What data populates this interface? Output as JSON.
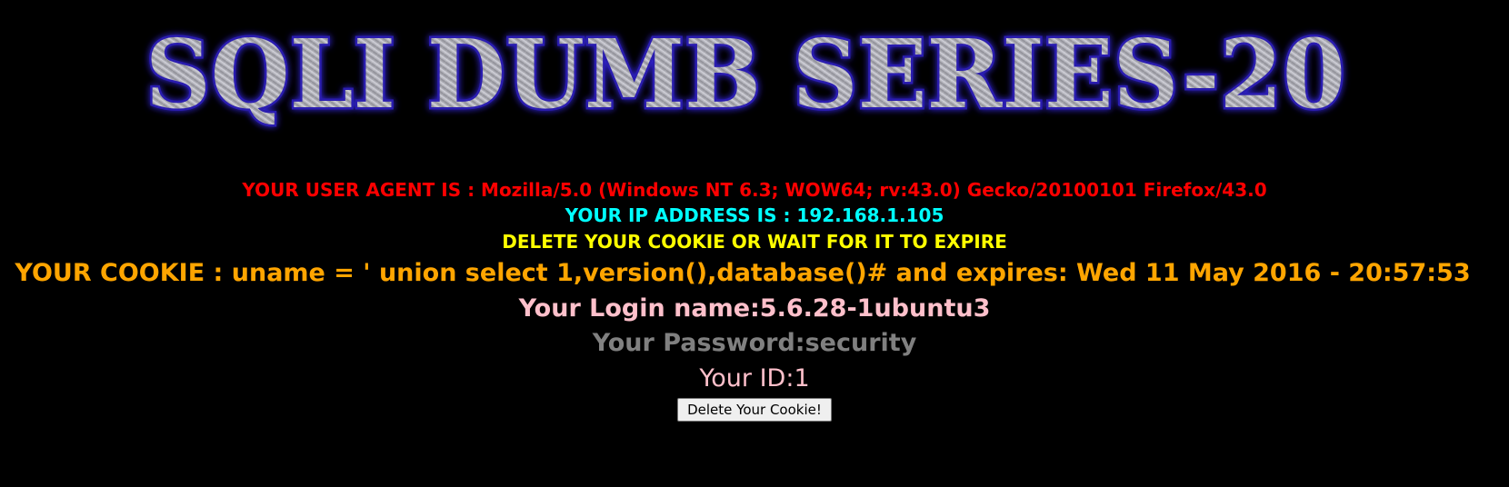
{
  "banner": {
    "text": "SQLI DUMB SERIES-20"
  },
  "info": {
    "user_agent": "YOUR USER AGENT IS : Mozilla/5.0 (Windows NT 6.3; WOW64; rv:43.0) Gecko/20100101 Firefox/43.0",
    "ip_address": "YOUR IP ADDRESS IS : 192.168.1.105",
    "delete_notice": "DELETE YOUR COOKIE OR WAIT FOR IT TO EXPIRE",
    "cookie": "YOUR COOKIE : uname = ' union select 1,version(),database()# and expires: Wed 11 May 2016 - 20:57:53",
    "login_name": "Your Login name:5.6.28-1ubuntu3",
    "password": "Your Password:security",
    "id": "Your ID:1"
  },
  "form": {
    "delete_button_label": "Delete Your Cookie!"
  },
  "colors": {
    "background": "#000000",
    "user_agent": "#ff0000",
    "ip_address": "#00ffff",
    "delete_notice": "#ffff00",
    "cookie": "#ffa500",
    "login_name": "#ffc0cb",
    "password": "#808080",
    "id": "#ffc0cb",
    "banner_outline": "#2a1fb0"
  }
}
